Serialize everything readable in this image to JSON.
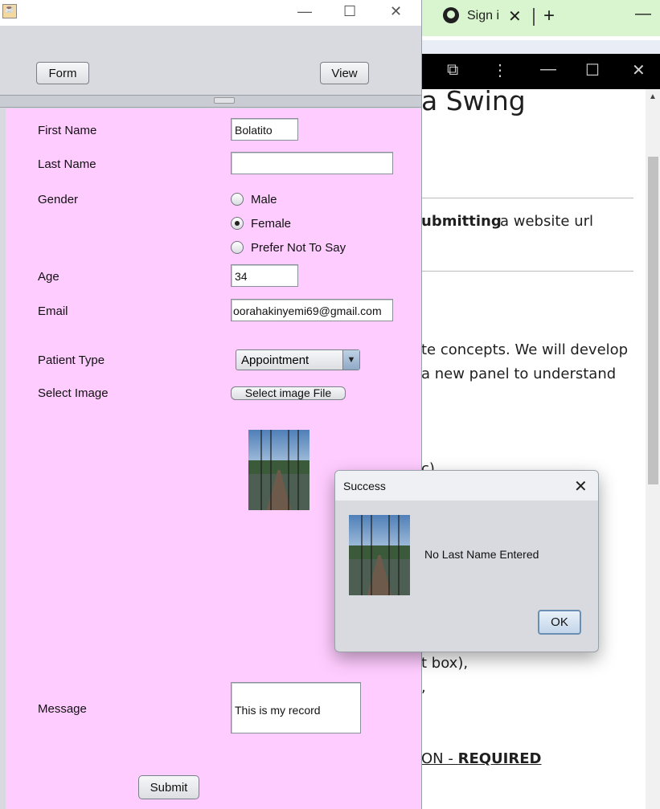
{
  "browser": {
    "tab_title": "Sign i",
    "tab_close": "✕",
    "new_tab": "+",
    "minimize": "—",
    "page_heading": "a Swing",
    "line1_bold": "ubmitting",
    "line1_rest": "a website url",
    "line2": "te concepts. We will develop",
    "line3": "a new panel to understand",
    "line4": "c)",
    "line5": "t box),",
    "line6": ",",
    "line7_prefix": "ON - ",
    "line7_bold": "REQUIRED"
  },
  "swing": {
    "window_controls": {
      "minimize": "—",
      "maximize": "☐",
      "close": "✕"
    },
    "toolbar": {
      "form_label": "Form",
      "view_label": "View"
    },
    "form": {
      "first_name_label": "First Name",
      "first_name_value": "Bolatito",
      "last_name_label": "Last Name",
      "last_name_value": "",
      "gender_label": "Gender",
      "gender_options": [
        "Male",
        "Female",
        "Prefer Not To Say"
      ],
      "gender_selected": "Female",
      "age_label": "Age",
      "age_value": "34",
      "email_label": "Email",
      "email_value": "oorahakinyemi69@gmail.com",
      "patient_type_label": "Patient Type",
      "patient_type_value": "Appointment",
      "select_image_label": "Select Image",
      "select_image_button": "Select image File",
      "message_label": "Message",
      "message_value": "This is my record",
      "submit_label": "Submit"
    }
  },
  "dialog": {
    "title": "Success",
    "close": "✕",
    "message": "No Last Name Entered",
    "ok_label": "OK"
  },
  "colors": {
    "form_background": "#ffccff",
    "window_background": "#d8dadf",
    "devtools_bar": "#000000",
    "tab_background": "#d9f5cf"
  }
}
